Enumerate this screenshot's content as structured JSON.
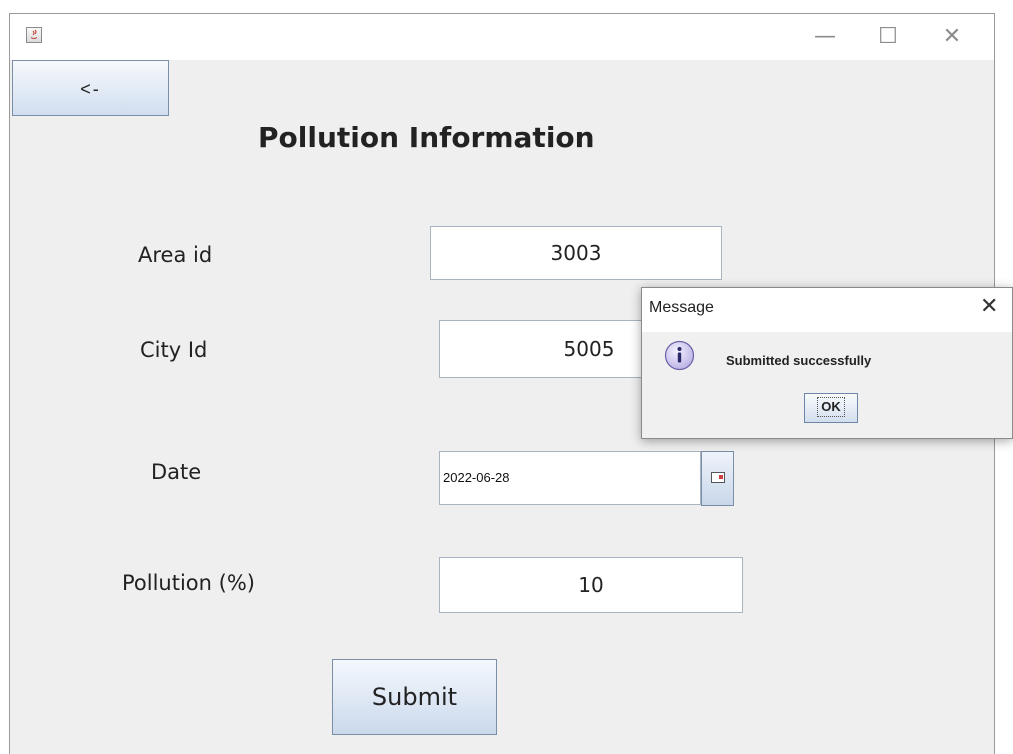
{
  "window": {
    "title": "",
    "controls": {
      "minimize": "—",
      "maximize": "☐",
      "close": "✕"
    }
  },
  "form": {
    "back_label": "<-",
    "title": "Pollution Information",
    "area_id_label": "Area id",
    "area_id_value": "3003",
    "city_id_label": "City Id",
    "city_id_value": "5005",
    "date_label": "Date",
    "date_value": "2022-06-28",
    "pollution_label": "Pollution (%)",
    "pollution_value": "10",
    "submit_label": "Submit"
  },
  "dialog": {
    "title": "Message",
    "close": "✕",
    "icon": "info-icon",
    "message": "Submitted successfully",
    "ok_label": "OK"
  },
  "colors": {
    "background": "#efefef",
    "button_gradient_top": "#f4f8fd",
    "button_gradient_bottom": "#cbd9ec",
    "info_icon": "#c9c2ea"
  }
}
